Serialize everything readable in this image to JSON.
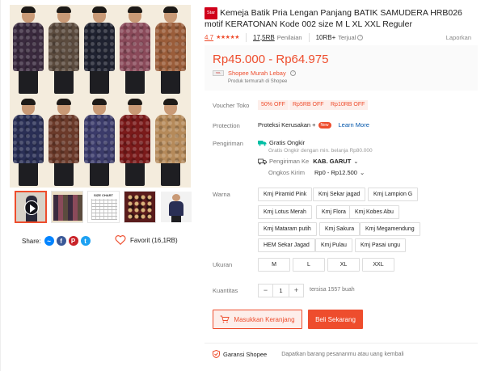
{
  "gallery": {
    "main_label": "",
    "thumbs": [
      "video",
      "batik-models",
      "size-chart",
      "batik-fabric",
      "model-single"
    ],
    "size_chart_title": "SIZE CHART",
    "shirt_colors": [
      "#3a2a3e",
      "#5b4b3e",
      "#1f2230",
      "#8a4a5a",
      "#9a5d3a",
      "#2a2f55",
      "#6b3a2a",
      "#3b3b6a",
      "#7a1a1a",
      "#b58a5a"
    ]
  },
  "share": {
    "label": "Share:",
    "favorite_label": "Favorit (16,1RB)"
  },
  "product": {
    "badge": "Star",
    "title": "Kemeja Batik Pria Lengan Panjang BATIK SAMUDERA HRB026 motif KERATONAN Kode 002 size M L XL XXL Reguler",
    "rating": "4.7",
    "stars": "★★★★★",
    "ratings_count": "17,5RB",
    "ratings_label": "Penilaian",
    "sold_count": "10RB+",
    "sold_label": "Terjual",
    "report_label": "Laporkan",
    "price": "Rp45.000 - Rp64.975",
    "shop_logo": "SML",
    "shop_name": "Shopee Murah Lebay",
    "shop_sub": "Produk termurah di Shopee"
  },
  "voucher": {
    "label": "Voucher Toko",
    "items": [
      "50% OFF",
      "Rp5RB OFF",
      "Rp10RB OFF"
    ]
  },
  "protection": {
    "label": "Protection",
    "name": "Proteksi Kerusakan +",
    "new": "New",
    "learn": "Learn More"
  },
  "shipping": {
    "label": "Pengiriman",
    "free": "Gratis Ongkir",
    "free_sub": "Gratis Ongkir dengan min. belanja Rp80.000",
    "to_label": "Pengiriman Ke",
    "to_value": "KAB. GARUT",
    "cost_label": "Ongkos Kirim",
    "cost_value": "Rp0 - Rp12.500"
  },
  "variants": {
    "color_label": "Warna",
    "colors": [
      "Kmj Piramid Pink",
      "Kmj Sekar jagad",
      "Kmj Lampion G",
      "Kmj Lotus Merah",
      "Kmj Flora",
      "Kmj Kobes Abu",
      "Kmj Mataram putih",
      "Kmj Sakura",
      "Kmj Megamendung",
      "HEM Sekar Jagad",
      "Kmj Pulau",
      "Kmj Pasai ungu"
    ],
    "size_label": "Ukuran",
    "sizes": [
      "M",
      "L",
      "XL",
      "XXL"
    ]
  },
  "quantity": {
    "label": "Kuantitas",
    "minus": "−",
    "value": "1",
    "plus": "+",
    "stock": "tersisa 1557 buah"
  },
  "actions": {
    "cart": "Masukkan Keranjang",
    "buy": "Beli Sekarang"
  },
  "guarantee": {
    "name": "Garansi Shopee",
    "text": "Dapatkan barang pesananmu atau uang kembali"
  },
  "colors": {
    "accent": "#ee4d2d"
  }
}
